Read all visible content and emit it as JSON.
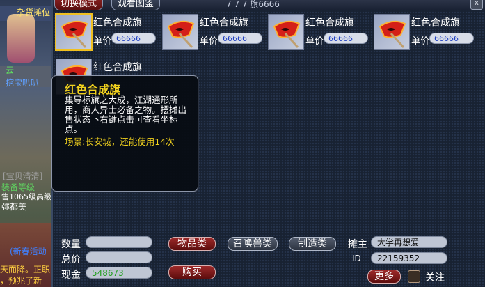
{
  "tabs": {
    "switch_mode": "切换模式",
    "view_map": "观看图鉴"
  },
  "top_marks": "7 7 7 旗6666",
  "close": "x",
  "scene": {
    "texts": [
      "杂货摊位",
      "云",
      "挖宝叭叭",
      "[宝贝清清]",
      "装备等级",
      "售1065级高级",
      "弥都美",
      "(新春活动",
      "天而降。正职",
      "，预兆了新"
    ]
  },
  "items": [
    {
      "name": "红色合成旗",
      "price_label": "单价",
      "price": "66666",
      "selected": true
    },
    {
      "name": "红色合成旗",
      "price_label": "单价",
      "price": "66666",
      "selected": false
    },
    {
      "name": "红色合成旗",
      "price_label": "单价",
      "price": "66666",
      "selected": false
    },
    {
      "name": "红色合成旗",
      "price_label": "单价",
      "price": "66666",
      "selected": false
    },
    {
      "name": "红色合成旗",
      "price_label": "",
      "price": "",
      "selected": false
    }
  ],
  "tooltip": {
    "title": "红色合成旗",
    "description": "集导标旗之大成，江湖通形所用，商人异士必备之物。摆摊出售状态下右键点击可查看坐标点。",
    "scene_info": "场景:长安城，还能使用14次"
  },
  "form": {
    "quantity_label": "数量",
    "quantity_value": "",
    "total_label": "总价",
    "total_value": "",
    "cash_label": "现金",
    "cash_value": "548673",
    "category_goods": "物品类",
    "category_summon": "召唤兽类",
    "category_craft": "制造类",
    "buy": "购买",
    "owner_label": "摊主",
    "owner_value": "大学再想爱",
    "id_label": "ID",
    "id_value": "22159352",
    "more": "更多",
    "follow": "关注"
  },
  "colors": {
    "tooltip_title": "#f2d21e",
    "cash_value": "#22a020",
    "price_value": "#2040c0"
  },
  "icons": {
    "item_icon": "red-flag-icon",
    "close": "close-icon"
  }
}
